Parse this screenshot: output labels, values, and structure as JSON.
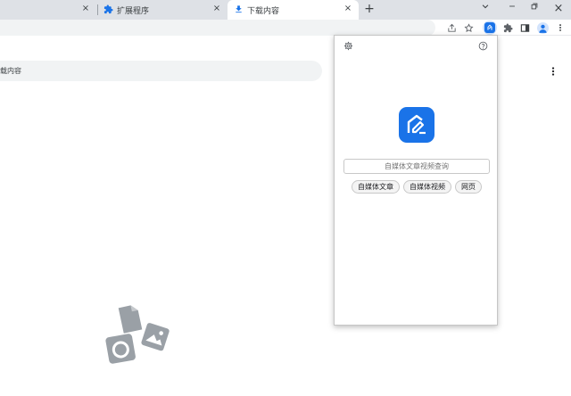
{
  "tabs": [
    {
      "label": "",
      "close": "×",
      "active": false
    },
    {
      "label": "扩展程序",
      "close": "×",
      "active": false
    },
    {
      "label": "下载内容",
      "close": "×",
      "active": true
    }
  ],
  "new_tab": "+",
  "window_controls": {
    "dropdown": "⌄",
    "minimize": "—",
    "restore": "❐",
    "close": "×"
  },
  "toolbar_icons": [
    "share-icon",
    "star-icon",
    "extension-active-icon",
    "puzzle-icon",
    "side-panel-icon",
    "profile-icon",
    "more-vert-icon"
  ],
  "downloads": {
    "search_placeholder": "载内容"
  },
  "popup": {
    "search_placeholder": "自媒体文章视频查询",
    "chips": [
      "自媒体文章",
      "自媒体视频",
      "网页"
    ]
  },
  "colors": {
    "accent": "#1a73e8",
    "tabstrip": "#dee1e6",
    "icon": "#5f6368"
  }
}
